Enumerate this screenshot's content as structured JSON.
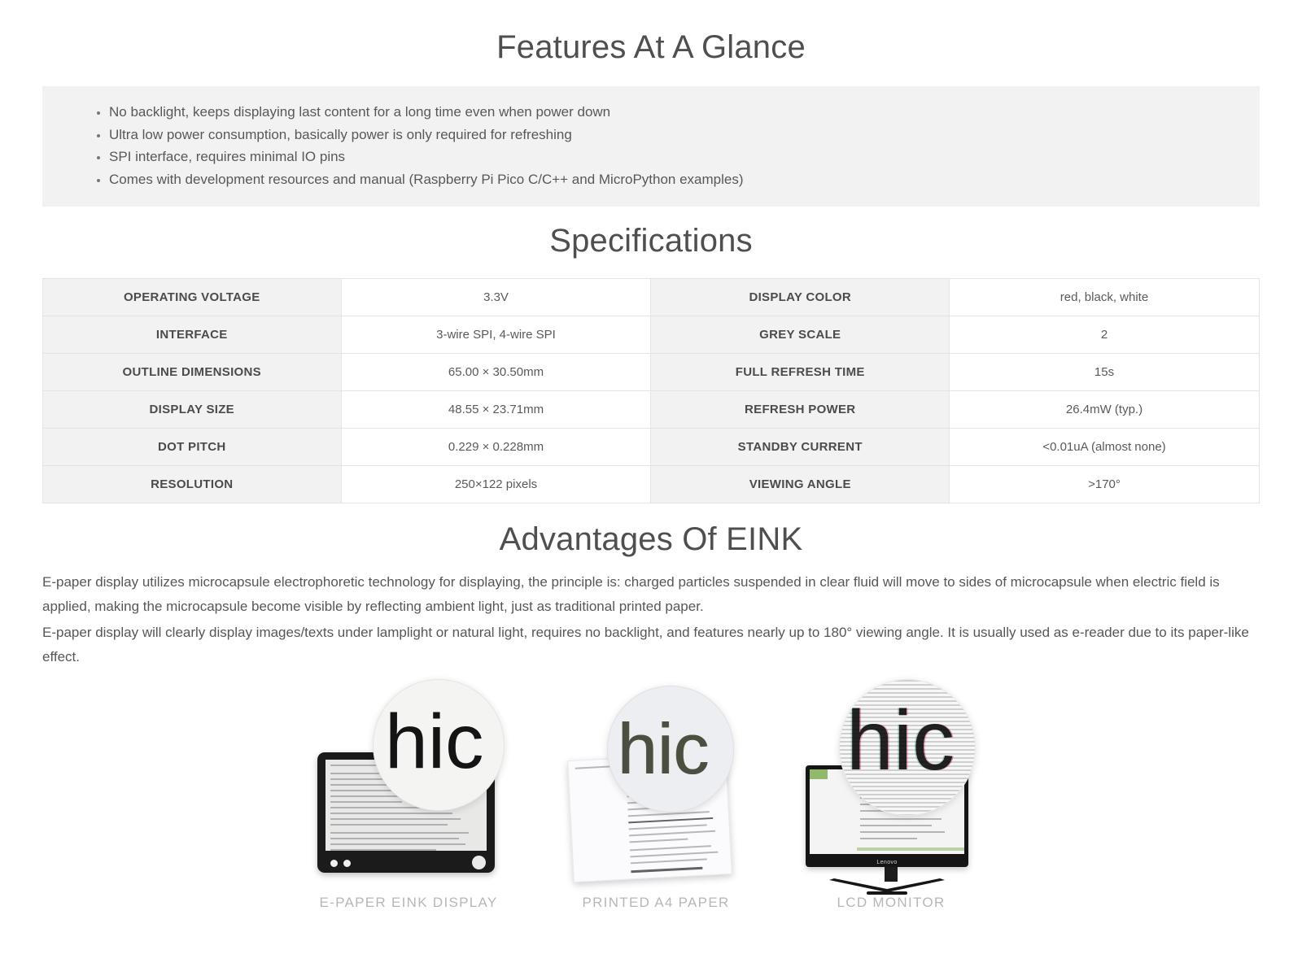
{
  "sections": {
    "features": {
      "heading": "Features At A Glance",
      "items": [
        "No backlight, keeps displaying last content for a long time even when power down",
        "Ultra low power consumption, basically power is only required for refreshing",
        "SPI interface, requires minimal IO pins",
        "Comes with development resources and manual (Raspberry Pi Pico C/C++ and MicroPython examples)"
      ]
    },
    "specifications": {
      "heading": "Specifications",
      "rows": [
        {
          "k1": "OPERATING VOLTAGE",
          "v1": "3.3V",
          "k2": "DISPLAY COLOR",
          "v2": "red, black, white"
        },
        {
          "k1": "INTERFACE",
          "v1": "3-wire SPI, 4-wire SPI",
          "k2": "GREY SCALE",
          "v2": "2"
        },
        {
          "k1": "OUTLINE DIMENSIONS",
          "v1": "65.00 × 30.50mm",
          "k2": "FULL REFRESH TIME",
          "v2": "15s"
        },
        {
          "k1": "DISPLAY SIZE",
          "v1": "48.55 × 23.71mm",
          "k2": "REFRESH POWER",
          "v2": "26.4mW (typ.)"
        },
        {
          "k1": "DOT PITCH",
          "v1": "0.229 × 0.228mm",
          "k2": "STANDBY CURRENT",
          "v2": "<0.01uA (almost none)"
        },
        {
          "k1": "RESOLUTION",
          "v1": "250×122 pixels",
          "k2": "VIEWING ANGLE",
          "v2": ">170°"
        }
      ]
    },
    "advantages": {
      "heading": "Advantages Of EINK",
      "paragraph1": "E-paper display utilizes microcapsule electrophoretic technology for displaying, the principle is: charged particles suspended in clear fluid will move to sides of microcapsule when electric field is applied, making the microcapsule become visible by reflecting ambient light, just as traditional printed paper.",
      "paragraph2": "E-paper display will clearly display images/texts under lamplight or natural light, requires no backlight, and features nearly up to 180° viewing angle. It is usually used as e-reader due to its paper-like effect.",
      "comparison": [
        {
          "caption": "E-PAPER EINK DISPLAY",
          "magnified_text": "hic"
        },
        {
          "caption": "PRINTED A4 PAPER",
          "magnified_text": "hic"
        },
        {
          "caption": "LCD MONITOR",
          "magnified_text": "hic"
        }
      ],
      "monitor_brand": "Lenovo"
    }
  },
  "colors": {
    "heading": "#4f4f4f",
    "body_text": "#575757",
    "panel_bg": "#f2f2f2",
    "table_border": "#e4e4e4",
    "caption": "#b7b7b7",
    "page_bg": "#ffffff"
  }
}
